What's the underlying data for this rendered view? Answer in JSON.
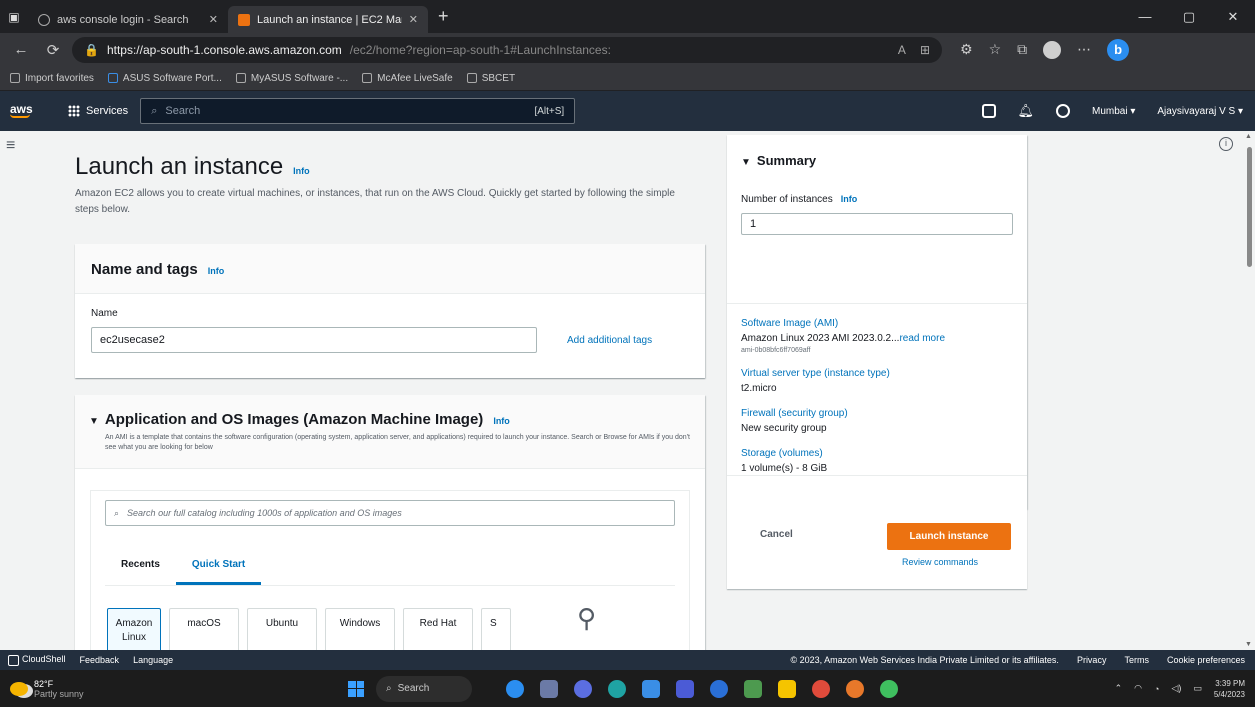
{
  "browser": {
    "tabs": [
      {
        "title": "aws console login - Search",
        "active": false
      },
      {
        "title": "Launch an instance | EC2 Manag",
        "active": true
      }
    ],
    "url_host": "https://ap-south-1.console.aws.amazon.com",
    "url_path": "/ec2/home?region=ap-south-1#LaunchInstances:",
    "favorites": [
      {
        "label": "Import favorites"
      },
      {
        "label": "ASUS Software Port..."
      },
      {
        "label": "MyASUS Software -..."
      },
      {
        "label": "McAfee LiveSafe"
      },
      {
        "label": "SBCET"
      }
    ]
  },
  "aws_header": {
    "logo": "aws",
    "services_label": "Services",
    "search_placeholder": "Search",
    "search_shortcut": "[Alt+S]",
    "region": "Mumbai ▾",
    "account": "Ajaysivayaraj V S ▾"
  },
  "page": {
    "title": "Launch an instance",
    "info": "Info",
    "description": "Amazon EC2 allows you to create virtual machines, or instances, that run on the AWS Cloud. Quickly get started by following the simple steps below."
  },
  "name_tags": {
    "title": "Name and tags",
    "info": "Info",
    "name_label": "Name",
    "name_value": "ec2usecase2",
    "add_tags_link": "Add additional tags"
  },
  "ami": {
    "title": "Application and OS Images (Amazon Machine Image)",
    "info": "Info",
    "description": "An AMI is a template that contains the software configuration (operating system, application server, and applications) required to launch your instance. Search or Browse for AMIs if you don't see what you are looking for below",
    "search_placeholder": "Search our full catalog including 1000s of application and OS images",
    "tabs": [
      "Recents",
      "Quick Start"
    ],
    "selected_tab": "Quick Start",
    "os_options": [
      {
        "label": "Amazon Linux",
        "selected": true
      },
      {
        "label": "macOS",
        "selected": false
      },
      {
        "label": "Ubuntu",
        "selected": false
      },
      {
        "label": "Windows",
        "selected": false
      },
      {
        "label": "Red Hat",
        "selected": false
      },
      {
        "label": "S",
        "selected": false
      }
    ]
  },
  "summary": {
    "title": "Summary",
    "num_instances_label": "Number of instances",
    "info": "Info",
    "num_instances_value": "1",
    "software_image_label": "Software Image (AMI)",
    "software_image_value": "Amazon Linux 2023 AMI 2023.0.2...",
    "read_more": "read more",
    "ami_id": "ami-0b08bfc6ff7069aff",
    "server_type_label": "Virtual server type (instance type)",
    "server_type_value": "t2.micro",
    "firewall_label": "Firewall (security group)",
    "firewall_value": "New security group",
    "storage_label": "Storage (volumes)",
    "storage_value": "1 volume(s) - 8 GiB",
    "cancel": "Cancel",
    "launch": "Launch instance",
    "review_commands": "Review commands"
  },
  "aws_footer": {
    "cloudshell": "CloudShell",
    "feedback": "Feedback",
    "language": "Language",
    "copyright": "© 2023, Amazon Web Services India Private Limited or its affiliates.",
    "privacy": "Privacy",
    "terms": "Terms",
    "cookie": "Cookie preferences"
  },
  "taskbar": {
    "temp": "82°F",
    "weather": "Partly sunny",
    "search": "Search",
    "time": "3:39 PM",
    "date": "5/4/2023"
  },
  "colors": {
    "aws_nav": "#232f3e",
    "aws_orange": "#ec7211",
    "link_blue": "#0073bb"
  }
}
